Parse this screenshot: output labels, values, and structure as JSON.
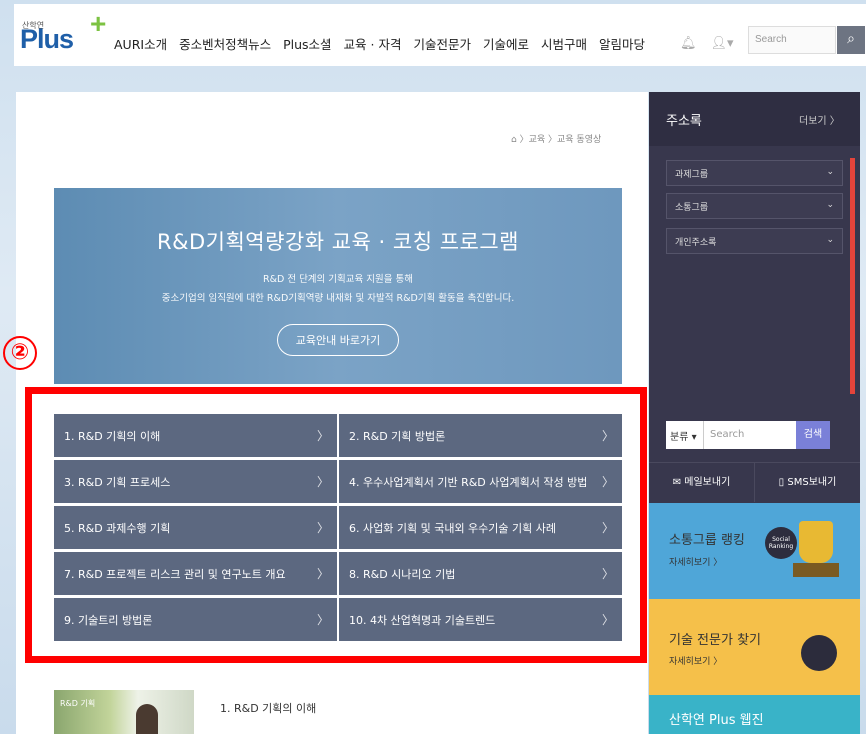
{
  "header": {
    "logo_small": "산학연",
    "logo_text": "Plus",
    "logo_mark": "+",
    "nav": [
      "AURI소개",
      "중소벤처정책뉴스",
      "Plus소셜",
      "교육 · 자격",
      "기술전문가",
      "기술에로",
      "시범구매",
      "알림마당"
    ],
    "search_placeholder": "Search",
    "icons": [
      "bell-icon",
      "user-icon",
      "search-icon"
    ]
  },
  "breadcrumb": "⌂ 〉교육 〉교육 동영상",
  "hero": {
    "title": "R&D기획역량강화 교육 · 코칭 프로그램",
    "line1": "R&D 전 단계의 기획교육 지원을 통해",
    "line2": "중소기업의 임직원에 대한 R&D기획역량 내재화 및 자발적 R&D기획 활동을 촉진합니다.",
    "button": "교육안내 바로가기"
  },
  "marker": "②",
  "courses": [
    "1. R&D 기획의 이해",
    "2. R&D 기획 방법론",
    "3. R&D 기획 프로세스",
    "4. 우수사업계획서 기반 R&D 사업계획서 작성 방법",
    "5. R&D 과제수행 기획",
    "6. 사업화 기획 및 국내외 우수기술 기획 사례",
    "7. R&D 프로젝트 리스크 관리 및 연구노트 개요",
    "8. R&D 시나리오 기법",
    "9. 기술트리 방법론",
    "10. 4차 산업혁명과 기술트렌드"
  ],
  "video": {
    "thumb_label": "R&D 기획",
    "title": "1. R&D 기획의 이해"
  },
  "sidebar": {
    "title": "주소록",
    "more": "더보기 〉",
    "selects": [
      "과제그룹",
      "소통그룹",
      "개인주소록"
    ],
    "category": "분류",
    "search_placeholder": "Search",
    "search_button": "검색",
    "mail": "메일보내기",
    "sms": "SMS보내기",
    "banner1_title": "소통그룹 랭킹",
    "banner1_sub": "자세히보기 〉",
    "banner1_badge": "Social Ranking",
    "banner2_title": "기술 전문가 찾기",
    "banner2_sub": "자세히보기 〉",
    "banner3_title": "산학연 Plus 웹진"
  }
}
